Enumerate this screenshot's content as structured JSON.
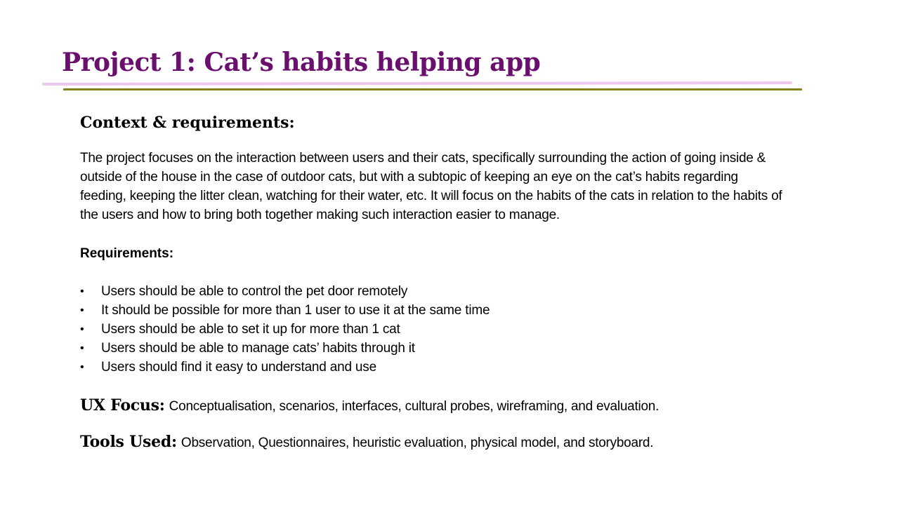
{
  "slide": {
    "title": "Project 1: Cat’s habits helping app"
  },
  "context": {
    "heading": "Context & requirements:",
    "paragraph": "The project focuses on the interaction between users and their cats, specifically surrounding the action of going inside & outside of the house in the case of outdoor cats, but with a subtopic of keeping an eye on the cat’s habits regarding feeding, keeping the litter clean, watching for their water, etc. It will focus on the habits of the cats in relation to the habits of the users and how to bring both together making such interaction easier to manage."
  },
  "requirements": {
    "heading": "Requirements:",
    "bullet_symbol": "•",
    "items": [
      "Users should be able to control the pet door remotely",
      "It should be possible for more than 1 user to use it at the same time",
      "Users should be able to set it up for more than 1 cat",
      "Users should be able to manage cats’ habits through it",
      "Users should find it easy to understand and use"
    ]
  },
  "ux_focus": {
    "label": "UX Focus:",
    "text": "Conceptualisation, scenarios, interfaces, cultural probes, wireframing, and evaluation."
  },
  "tools_used": {
    "label": "Tools Used:",
    "text": "Observation, Questionnaires, heuristic evaluation, physical model, and storyboard."
  },
  "colors": {
    "title": "#6b0f6e",
    "rule_pink": "#efc6ee",
    "rule_olive": "#858018"
  }
}
